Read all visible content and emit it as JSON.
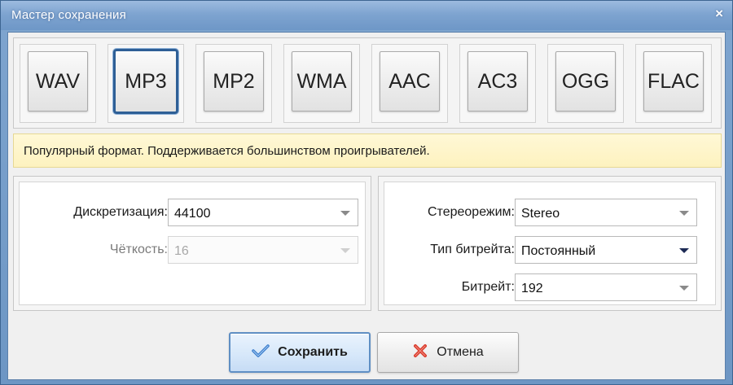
{
  "window": {
    "title": "Мастер сохранения",
    "close_glyph": "×"
  },
  "formats": {
    "selected": "MP3",
    "items": [
      "WAV",
      "MP3",
      "MP2",
      "WMA",
      "AAC",
      "AC3",
      "OGG",
      "FLAC"
    ]
  },
  "info": {
    "text": "Популярный формат. Поддерживается большинством проигрывателей."
  },
  "left_panel": {
    "sample_rate": {
      "label": "Дискретизация:",
      "value": "44100"
    },
    "bit_depth": {
      "label": "Чёткость:",
      "value": "16",
      "disabled": true
    }
  },
  "right_panel": {
    "stereo_mode": {
      "label": "Стереорежим:",
      "value": "Stereo"
    },
    "bitrate_type": {
      "label": "Тип битрейта:",
      "value": "Постоянный"
    },
    "bitrate": {
      "label": "Битрейт:",
      "value": "192"
    }
  },
  "actions": {
    "save_label": "Сохранить",
    "cancel_label": "Отмена"
  },
  "icons": {
    "save": "check-icon",
    "cancel": "x-mark-icon",
    "dropdown": "chevron-down-icon"
  },
  "colors": {
    "titlebar": "#7ea4d0",
    "selected_border": "#2e5f96",
    "info_bg": "#fdf2bf",
    "check_blue": "#3b7ccc",
    "cancel_red": "#d93a2b"
  }
}
